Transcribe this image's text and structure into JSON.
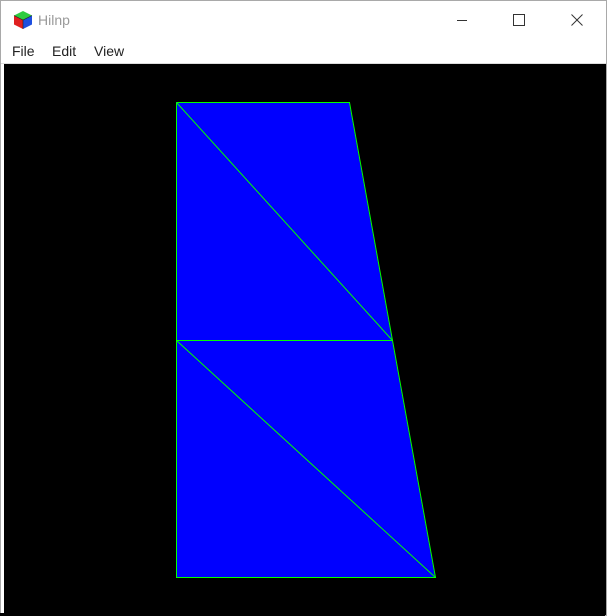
{
  "window": {
    "title": "Hilnp",
    "app_icon": "rgb-cube-icon",
    "controls": {
      "minimize_icon": "minimize-icon",
      "maximize_icon": "maximize-icon",
      "close_icon": "close-icon"
    }
  },
  "menu": {
    "items": [
      "File",
      "Edit",
      "View"
    ]
  },
  "viewport": {
    "background": "#000000",
    "mesh": {
      "fill_color": "#0000ff",
      "edge_color": "#00ff00",
      "triangles": 4
    }
  }
}
